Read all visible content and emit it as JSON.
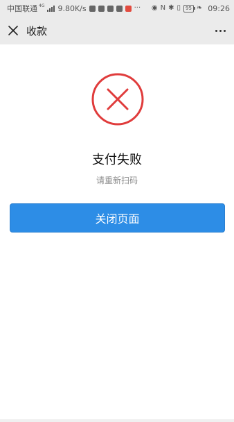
{
  "status_bar": {
    "carrier": "中国联通",
    "network_type": "4G",
    "net_speed": "9.80K/s",
    "battery": "95",
    "time": "09:26",
    "icons": [
      "signal-icon",
      "wechat-icon",
      "briefcase-icon",
      "qq-icon",
      "cloud-icon",
      "app-icon",
      "more-notifications-icon",
      "eye-icon",
      "nfc-icon",
      "bluetooth-icon",
      "vibrate-icon",
      "battery-icon",
      "leaf-icon"
    ]
  },
  "nav": {
    "close_icon": "close-icon",
    "title": "收款",
    "more_icon": "more-icon"
  },
  "result": {
    "icon": "error-circle-x-icon",
    "icon_color": "#e03c3c",
    "title": "支付失败",
    "subtitle": "请重新扫码"
  },
  "actions": {
    "close_page_label": "关闭页面",
    "button_color": "#2d8de6"
  }
}
